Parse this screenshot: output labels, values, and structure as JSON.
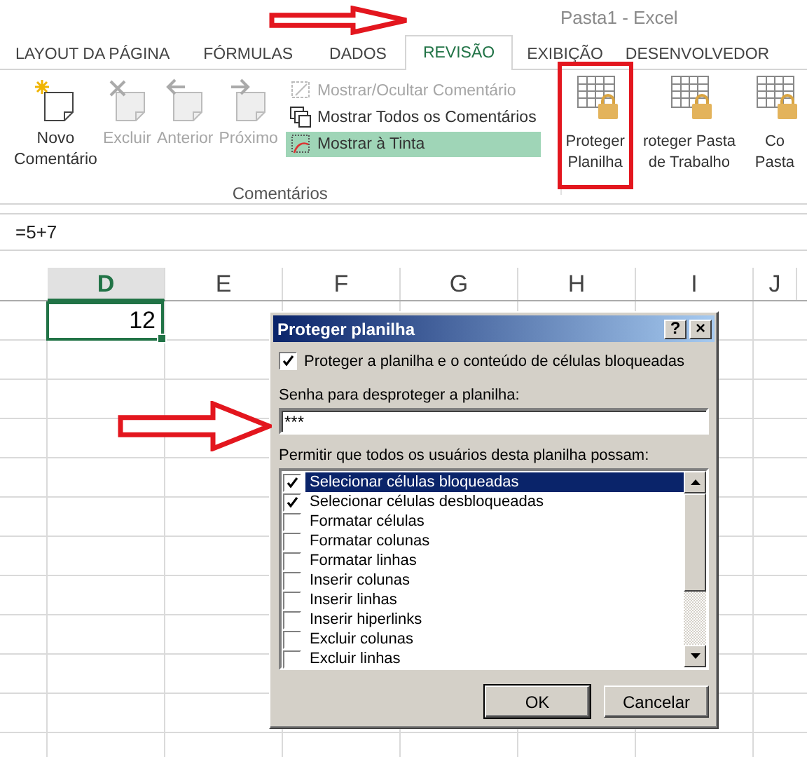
{
  "window": {
    "title": "Pasta1 - Excel"
  },
  "tabs": [
    {
      "label": "LAYOUT DA PÁGINA",
      "selected": false
    },
    {
      "label": "FÓRMULAS",
      "selected": false
    },
    {
      "label": "DADOS",
      "selected": false
    },
    {
      "label": "REVISÃO",
      "selected": true
    },
    {
      "label": "EXIBIÇÃO",
      "selected": false
    },
    {
      "label": "DESENVOLVEDOR",
      "selected": false
    }
  ],
  "ribbon": {
    "comment_buttons": [
      {
        "kind": "new",
        "label": "Novo\nComentário",
        "disabled": false
      },
      {
        "kind": "delete",
        "label": "Excluir",
        "disabled": true
      },
      {
        "kind": "previous",
        "label": "Anterior",
        "disabled": true
      },
      {
        "kind": "next",
        "label": "Próximo",
        "disabled": true
      }
    ],
    "comment_options": [
      {
        "kind": "toggle",
        "label": "Mostrar/Ocultar Comentário",
        "disabled": true,
        "selected": false
      },
      {
        "kind": "show_all",
        "label": "Mostrar Todos os Comentários",
        "disabled": false,
        "selected": false
      },
      {
        "kind": "ink",
        "label": "Mostrar à Tinta",
        "disabled": false,
        "selected": true
      }
    ],
    "group_label": "Comentários",
    "protect_buttons": [
      {
        "label": "Proteger\nPlanilha",
        "highlighted": true
      },
      {
        "label": "roteger Pasta\nde Trabalho",
        "highlighted": false
      },
      {
        "label": "Co\nPasta",
        "highlighted": false
      }
    ]
  },
  "formula_bar": {
    "value": "=5+7"
  },
  "sheet": {
    "columns": [
      {
        "label": "D",
        "selected": true
      },
      {
        "label": "E",
        "selected": false
      },
      {
        "label": "F",
        "selected": false
      },
      {
        "label": "G",
        "selected": false
      },
      {
        "label": "H",
        "selected": false
      },
      {
        "label": "I",
        "selected": false
      },
      {
        "label": "J",
        "selected": false
      }
    ],
    "active_cell": {
      "value": "12"
    }
  },
  "dialog": {
    "title": "Proteger planilha",
    "help_button": "?",
    "close_button": "×",
    "protect_checkbox": {
      "label": "Proteger a planilha e o conteúdo de células bloqueadas",
      "checked": true
    },
    "password_label": "Senha para desproteger a planilha:",
    "password_value": "***",
    "permissions_label": "Permitir que todos os usuários desta planilha possam:",
    "permissions": [
      {
        "label": "Selecionar células bloqueadas",
        "checked": true,
        "selected": true
      },
      {
        "label": "Selecionar células desbloqueadas",
        "checked": true,
        "selected": false
      },
      {
        "label": "Formatar células",
        "checked": false,
        "selected": false
      },
      {
        "label": "Formatar colunas",
        "checked": false,
        "selected": false
      },
      {
        "label": "Formatar linhas",
        "checked": false,
        "selected": false
      },
      {
        "label": "Inserir colunas",
        "checked": false,
        "selected": false
      },
      {
        "label": "Inserir linhas",
        "checked": false,
        "selected": false
      },
      {
        "label": "Inserir hiperlinks",
        "checked": false,
        "selected": false
      },
      {
        "label": "Excluir colunas",
        "checked": false,
        "selected": false
      },
      {
        "label": "Excluir linhas",
        "checked": false,
        "selected": false
      }
    ],
    "buttons": [
      {
        "kind": "default",
        "label": "OK"
      },
      {
        "kind": "normal",
        "label": "Cancelar"
      }
    ]
  }
}
